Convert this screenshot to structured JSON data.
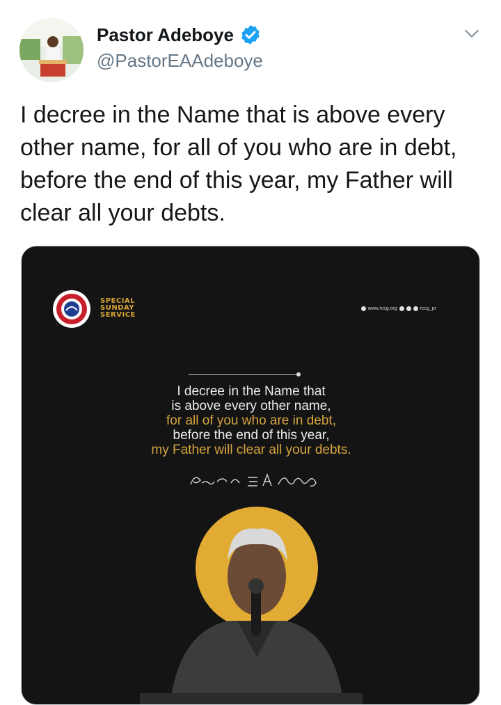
{
  "header": {
    "name": "Pastor Adeboye",
    "handle": "@PastorEAAdeboye",
    "verified_color": "#1da1f2"
  },
  "tweet": {
    "text": "I decree in the Name that is above every other name, for all of you who are in debt, before the end of this year, my Father will clear all your debts."
  },
  "media": {
    "logo_text": "THE REDEEMED CHRISTIAN CHURCH OF GOD",
    "service_lines": [
      "SPECIAL",
      "SUNDAY",
      "SERVICE"
    ],
    "website": "www.rccg.org",
    "social_handle": "rccg_pr",
    "quote_lines": [
      "I decree in the Name that",
      "is above every other name,",
      "for all of you who are in debt,",
      "before the end of this year,",
      "my Father will clear all your debts."
    ],
    "signature": "Pastor E.A. Adeboye",
    "accent_color": "#d6a33f",
    "halo_color": "#e2ac34"
  }
}
